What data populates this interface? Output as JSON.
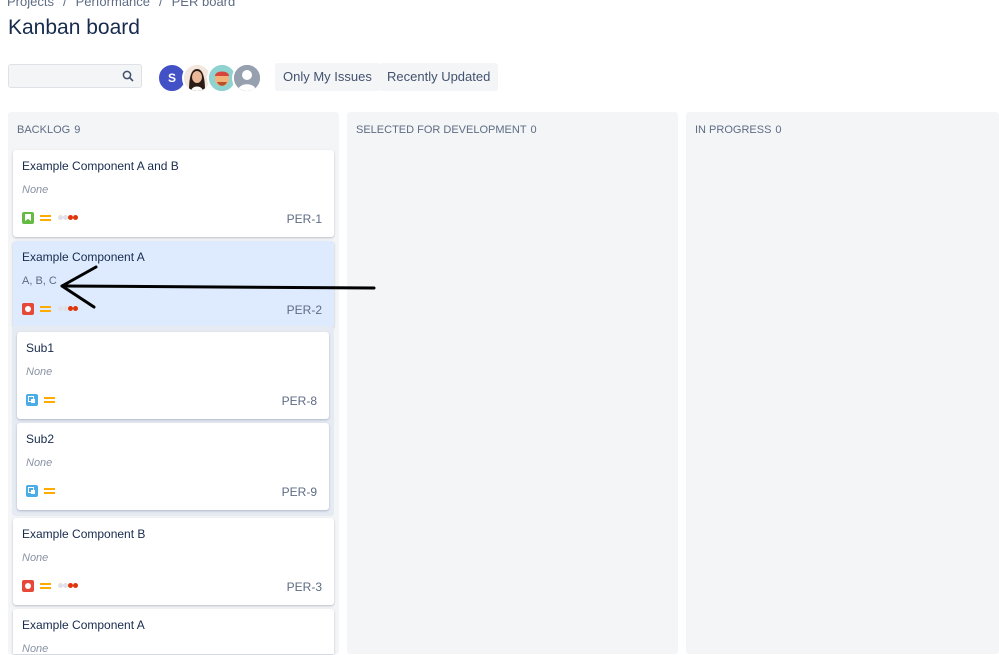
{
  "breadcrumb": {
    "items": [
      "Projects",
      "Performance",
      "PER board"
    ],
    "separator": "/"
  },
  "page": {
    "title": "Kanban board"
  },
  "search": {
    "value": "",
    "placeholder": ""
  },
  "avatars": [
    {
      "initial": "S",
      "color": "#4351c6"
    },
    {
      "initial": "",
      "color": "#f0e2d6"
    },
    {
      "initial": "",
      "color": "#8fd2cf"
    },
    {
      "initial": "",
      "color": "#97a0af"
    }
  ],
  "filters": {
    "only_my_issues": "Only My Issues",
    "recently_updated": "Recently Updated"
  },
  "columns": [
    {
      "title": "BACKLOG",
      "count": "9"
    },
    {
      "title": "SELECTED FOR DEVELOPMENT",
      "count": "0"
    },
    {
      "title": "IN PROGRESS",
      "count": "0"
    }
  ],
  "cards": [
    {
      "summary": "Example Component A and B",
      "sub": "None",
      "key": "PER-1",
      "type": "story-icon"
    },
    {
      "summary": "Example Component A",
      "sub": "A, B, C",
      "key": "PER-2",
      "type": "bug-icon"
    },
    {
      "summary": "Sub1",
      "sub": "None",
      "key": "PER-8",
      "type": "subtask-icon"
    },
    {
      "summary": "Sub2",
      "sub": "None",
      "key": "PER-9",
      "type": "subtask-icon"
    },
    {
      "summary": "Example Component B",
      "sub": "None",
      "key": "PER-3",
      "type": "bug-icon"
    },
    {
      "summary": "Example Component A",
      "sub": "None",
      "key": "",
      "type": ""
    }
  ],
  "colors": {
    "story": "#65ba43",
    "bug": "#e5493a",
    "subtask": "#4bade8",
    "priority_medium": "#ffab00",
    "selected_card": "#deebff"
  }
}
